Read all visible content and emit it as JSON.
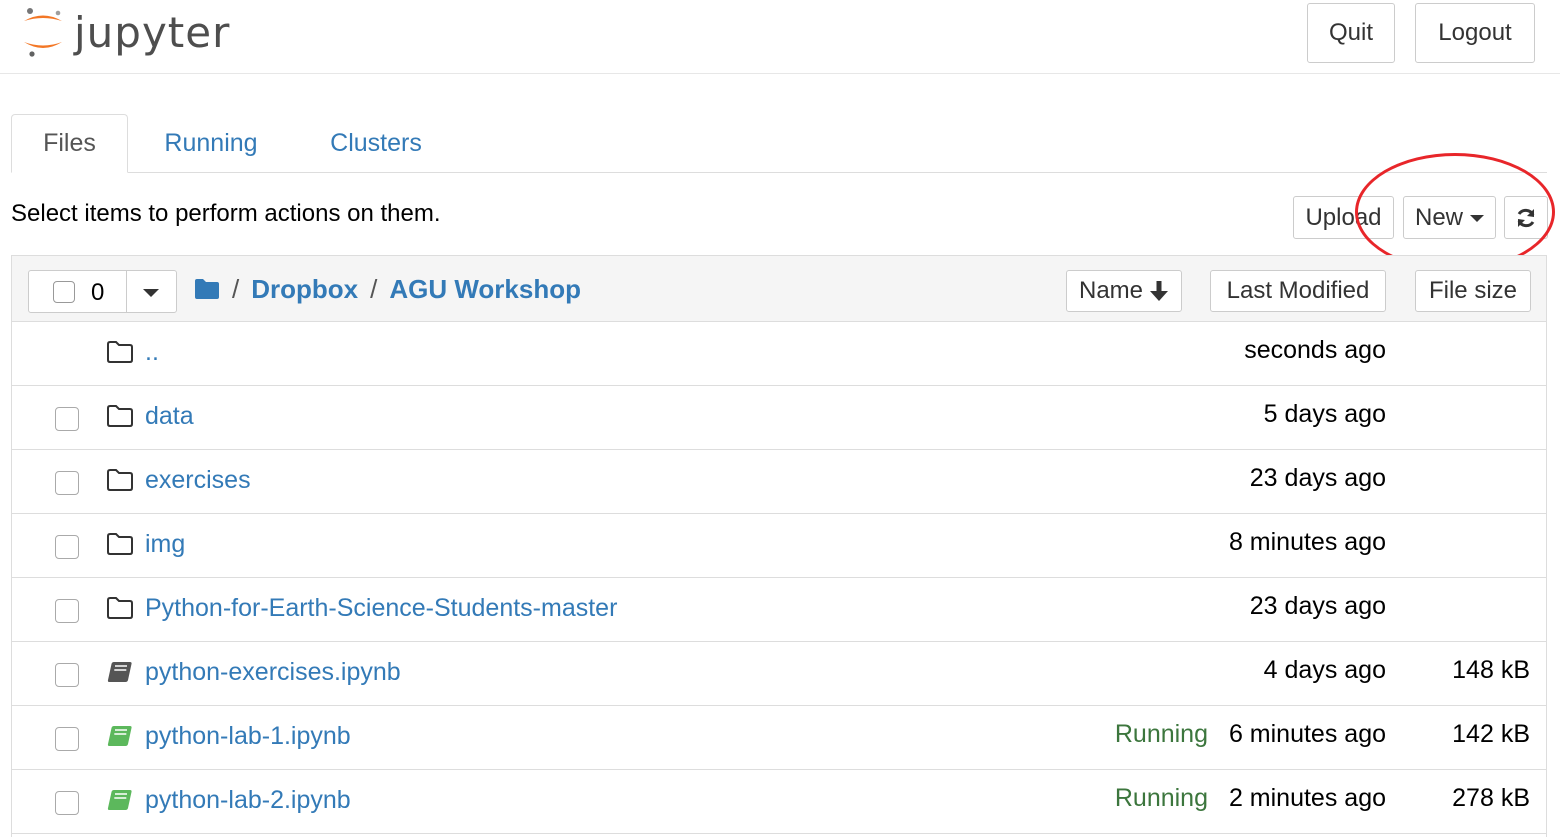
{
  "header": {
    "logo_text": "jupyter",
    "quit_label": "Quit",
    "logout_label": "Logout"
  },
  "tabs": [
    {
      "label": "Files",
      "active": true
    },
    {
      "label": "Running",
      "active": false
    },
    {
      "label": "Clusters",
      "active": false
    }
  ],
  "toolbar": {
    "hint": "Select items to perform actions on them.",
    "upload_label": "Upload",
    "new_label": "New",
    "refresh_icon": "refresh-icon"
  },
  "list_header": {
    "selected_count": "0",
    "breadcrumb_root": "/",
    "breadcrumb_sep": "/",
    "breadcrumb": [
      "Dropbox",
      "AGU Workshop"
    ],
    "sort_name_label": "Name",
    "sort_modified_label": "Last Modified",
    "sort_size_label": "File size"
  },
  "rows": [
    {
      "type": "folder",
      "name": "..",
      "status": "",
      "modified": "seconds ago",
      "size": "",
      "checkbox": false
    },
    {
      "type": "folder",
      "name": "data",
      "status": "",
      "modified": "5 days ago",
      "size": "",
      "checkbox": true
    },
    {
      "type": "folder",
      "name": "exercises",
      "status": "",
      "modified": "23 days ago",
      "size": "",
      "checkbox": true
    },
    {
      "type": "folder",
      "name": "img",
      "status": "",
      "modified": "8 minutes ago",
      "size": "",
      "checkbox": true
    },
    {
      "type": "folder",
      "name": "Python-for-Earth-Science-Students-master",
      "status": "",
      "modified": "23 days ago",
      "size": "",
      "checkbox": true
    },
    {
      "type": "notebook",
      "name": "python-exercises.ipynb",
      "status": "",
      "modified": "4 days ago",
      "size": "148 kB",
      "checkbox": true
    },
    {
      "type": "notebook-running",
      "name": "python-lab-1.ipynb",
      "status": "Running",
      "modified": "6 minutes ago",
      "size": "142 kB",
      "checkbox": true
    },
    {
      "type": "notebook-running",
      "name": "python-lab-2.ipynb",
      "status": "Running",
      "modified": "2 minutes ago",
      "size": "278 kB",
      "checkbox": true
    }
  ],
  "colors": {
    "link": "#337ab7",
    "running": "#3c763d",
    "annotation": "#e8262a",
    "logo_orange": "#f37726"
  }
}
